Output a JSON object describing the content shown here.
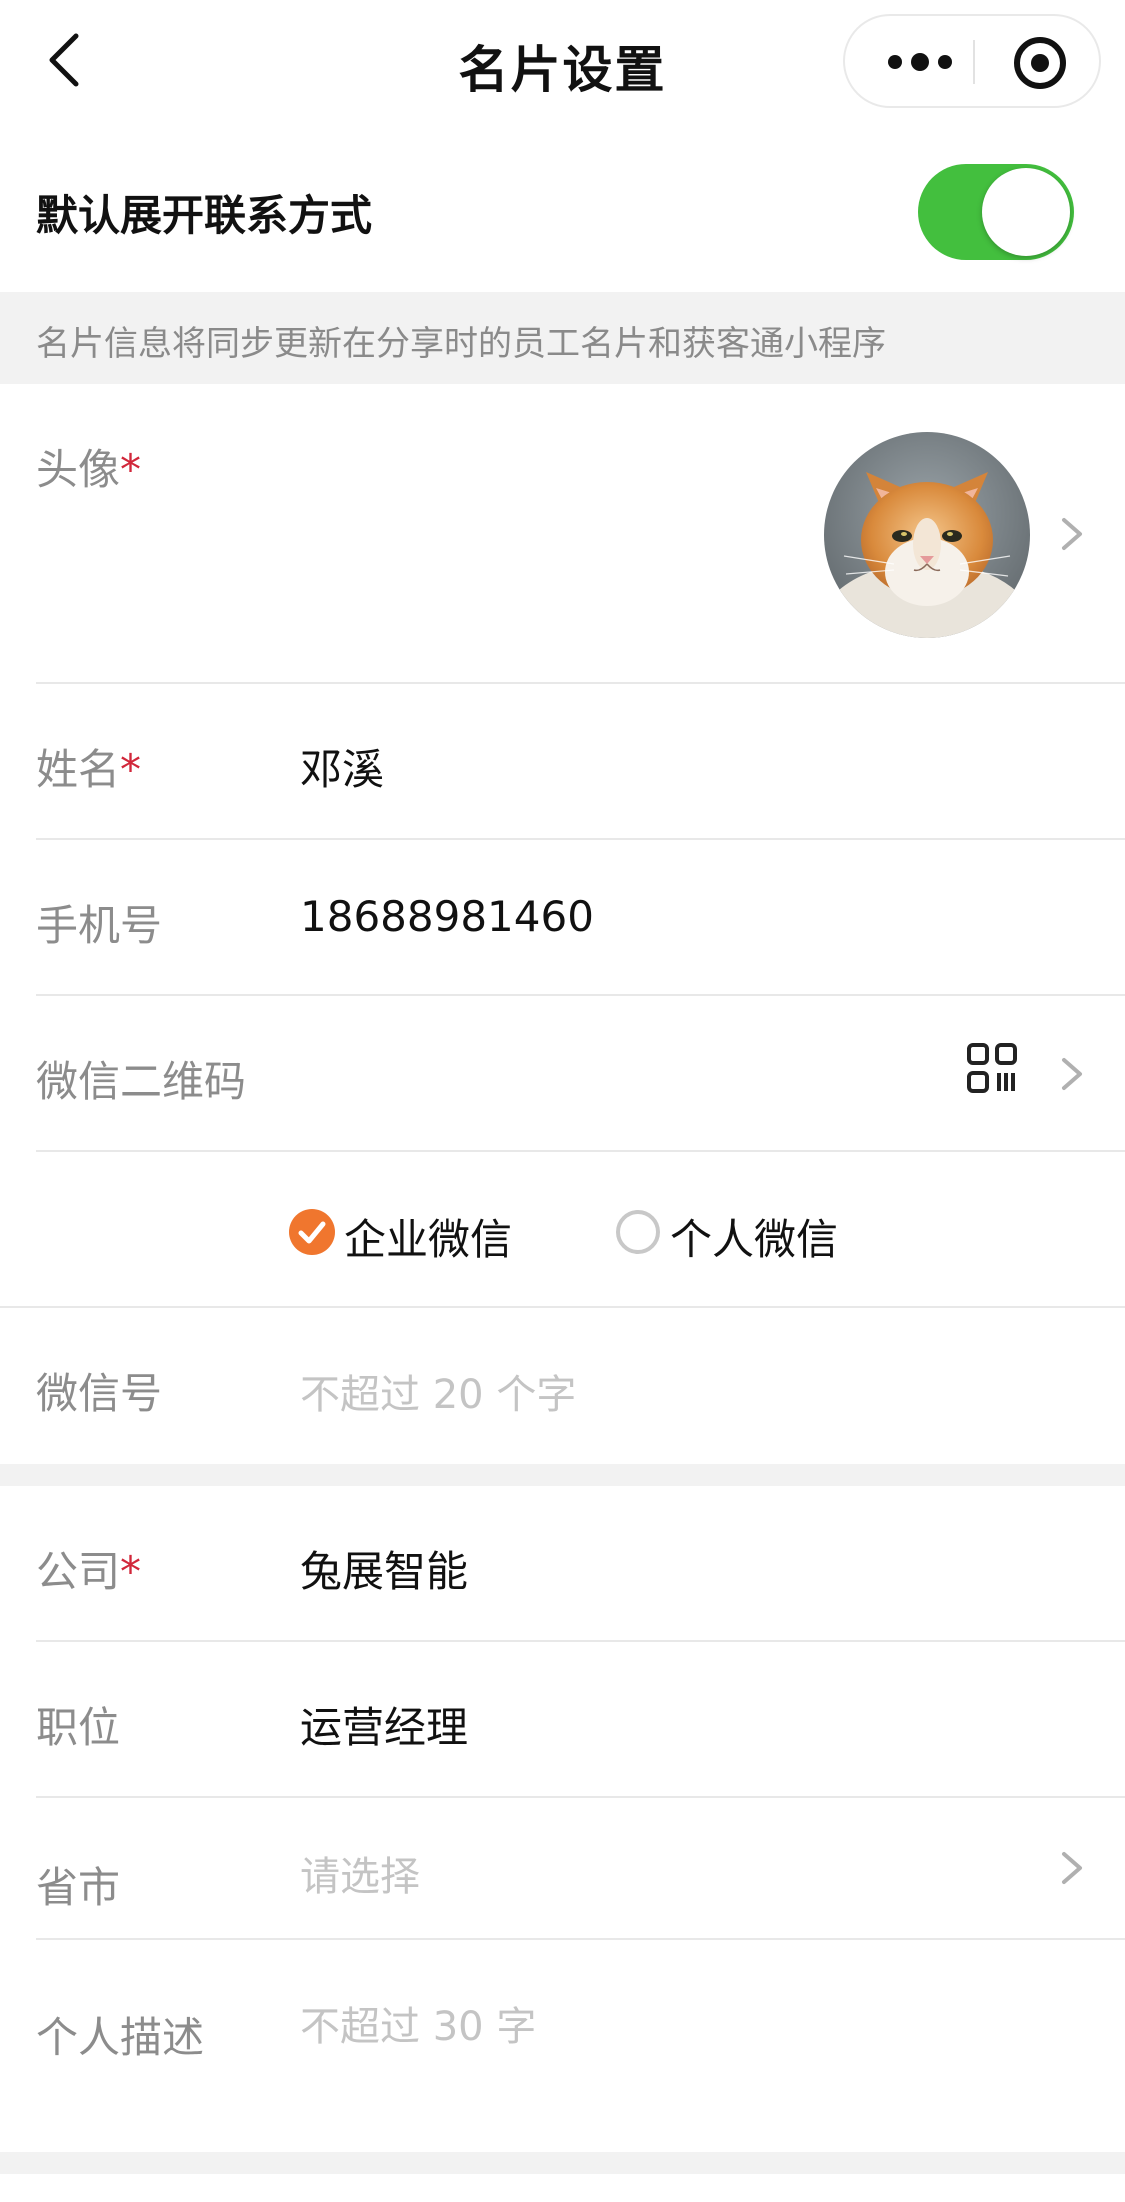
{
  "header": {
    "title": "名片设置",
    "back_icon": "back-arrow-icon",
    "more_icon": "more-dots-icon",
    "close_icon": "target-close-icon"
  },
  "toggle": {
    "label": "默认展开联系方式",
    "on": true,
    "color": "#43bf3e"
  },
  "notice": {
    "text": "名片信息将同步更新在分享时的员工名片和获客通小程序"
  },
  "form": {
    "avatar": {
      "label": "头像",
      "required_mark": "*",
      "icon": "chevron-right-icon"
    },
    "name": {
      "label": "姓名",
      "required_mark": "*",
      "value": "邓溪"
    },
    "phone": {
      "label": "手机号",
      "value": "18688981460"
    },
    "wechat_qr": {
      "label": "微信二维码",
      "icon": "qr-code-icon"
    },
    "wechat_type": {
      "options": [
        {
          "label": "企业微信",
          "checked": true
        },
        {
          "label": "个人微信",
          "checked": false
        }
      ],
      "checked_color": "#f0762e"
    },
    "wechat_id": {
      "label": "微信号",
      "placeholder": "不超过 20 个字"
    },
    "company": {
      "label": "公司",
      "required_mark": "*",
      "value": "兔展智能"
    },
    "position": {
      "label": "职位",
      "value": "运营经理"
    },
    "region": {
      "label": "省市",
      "placeholder": "请选择"
    },
    "description": {
      "label": "个人描述",
      "placeholder": "不超过 30 字"
    }
  },
  "colors": {
    "required": "#d1273a",
    "label": "#8c8c8c",
    "placeholder": "#c4c4c4"
  }
}
